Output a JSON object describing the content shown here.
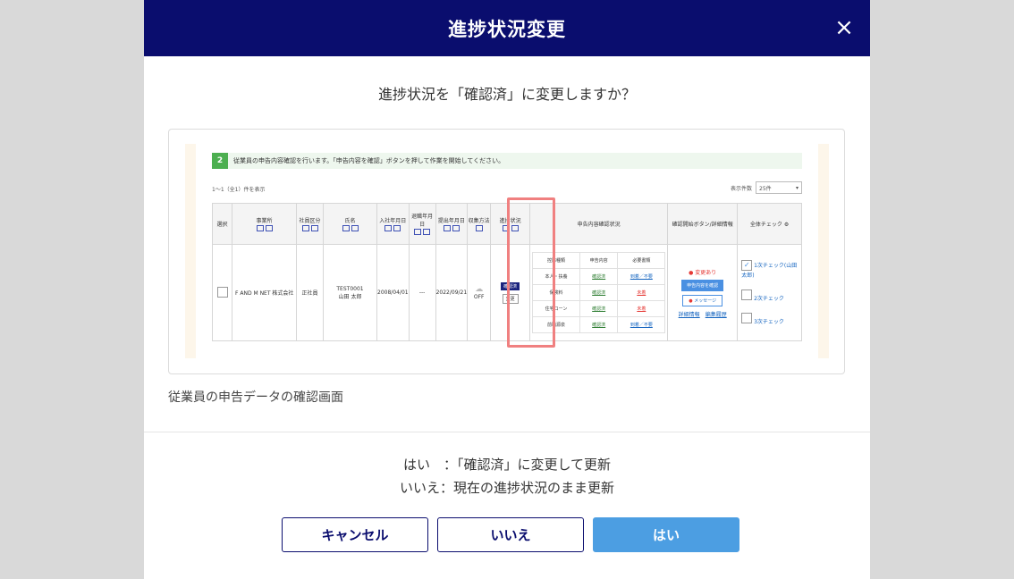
{
  "modal": {
    "title": "進捗状況変更",
    "close_symbol": "×",
    "question": "進捗状況を「確認済」に変更しますか？",
    "caption": "従業員の申告データの確認画面",
    "explain": [
      "はい　：「確認済」に変更して更新",
      "いいえ：現在の進捗状況のまま更新"
    ],
    "buttons": {
      "cancel": "キャンセル",
      "no": "いいえ",
      "yes": "はい"
    }
  },
  "preview": {
    "step_number": "2",
    "step_text": "従業員の申告内容確認を行います。「申告内容を確認」ボタンを押して作業を開始してください。",
    "count_text": "1〜1（全1）件を表示",
    "per_page_label": "表示件数",
    "per_page_value": "25件",
    "headers": {
      "select": "選択",
      "office": "事業所",
      "emp_type": "社員区分",
      "name": "氏名",
      "join_date": "入社年月日",
      "retire_date": "退職年月日",
      "submit_date": "提出年月日",
      "method": "収集方法",
      "progress": "進捗状況",
      "declaration": "申告内容確認状況",
      "confirm_btn": "確認開始ボタン/詳細情報",
      "all_check": "全体チェック"
    },
    "row": {
      "office": "F AND M NET 株式会社",
      "emp_type": "正社員",
      "emp_code": "TEST0001",
      "emp_name": "山田 太郎",
      "join_date": "2008/04/01",
      "retire_date": "---",
      "submit_date": "2022/09/21",
      "method": "OFF",
      "progress_badge": "確認済",
      "change_btn": "変更"
    },
    "sub_headers": [
      "控除種類",
      "申告内容",
      "必要書類"
    ],
    "sub_rows": [
      [
        "本人・扶養",
        "確認済",
        "到着／不要"
      ],
      [
        "保険料",
        "確認済",
        "未着"
      ],
      [
        "住宅ローン",
        "確認済",
        "未着"
      ],
      [
        "前職源泉",
        "確認済",
        "到着／不要"
      ]
    ],
    "change_notice": "変更あり",
    "confirm_content_btn": "申告内容を確認",
    "message_btn": "メッセージ",
    "links": [
      "詳細情報",
      "編集履歴"
    ],
    "checks": [
      "1次チェック(山田　太郎)",
      "2次チェック",
      "3次チェック"
    ]
  }
}
